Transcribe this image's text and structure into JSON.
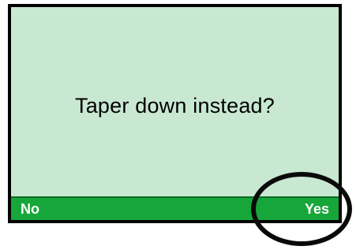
{
  "dialog": {
    "prompt": "Taper down instead?"
  },
  "softkeys": {
    "left_label": "No",
    "right_label": "Yes"
  },
  "colors": {
    "screen_background": "#c8e8d2",
    "softkey_bar": "#17a63a",
    "frame": "#000000"
  }
}
